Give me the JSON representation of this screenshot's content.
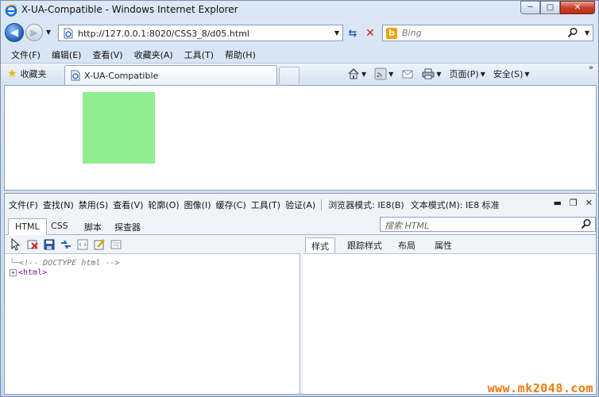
{
  "window": {
    "title": "X-UA-Compatible - Windows Internet Explorer",
    "controls": {
      "minimize": "─",
      "maximize": "□",
      "close": "✕"
    }
  },
  "address_bar": {
    "url": "http://127.0.0.1:8020/CSS3_8/d05.html",
    "search_placeholder": "Bing"
  },
  "menu": [
    "文件(F)",
    "编辑(E)",
    "查看(V)",
    "收藏夹(A)",
    "工具(T)",
    "帮助(H)"
  ],
  "favorites_bar": {
    "favorites_label": "收藏夹",
    "tab_label": "X-UA-Compatible",
    "page_menu": "页面(P)",
    "safety_menu": "安全(S)"
  },
  "devtools": {
    "menu": [
      "文件(F)",
      "查找(N)",
      "禁用(S)",
      "查看(V)",
      "轮廓(O)",
      "图像(I)",
      "缓存(C)",
      "工具(T)",
      "验证(A)"
    ],
    "browser_mode": "浏览器模式: IE8(B)",
    "document_mode": "文本模式(M): IE8 标准",
    "tabs": [
      "HTML",
      "CSS",
      "脚本",
      "探查器"
    ],
    "search_placeholder": "搜索 HTML",
    "tree": {
      "doctype_comment": "<!-- DOCTYPE html -->",
      "html_node": "<html>"
    },
    "right_tabs": [
      "样式",
      "跟踪样式",
      "布局",
      "属性"
    ]
  },
  "watermark": "www.mk2048.com",
  "colors": {
    "page_box": "#90ee90",
    "chrome_bg": "#cfdcec",
    "close_button": "#c7442f"
  }
}
